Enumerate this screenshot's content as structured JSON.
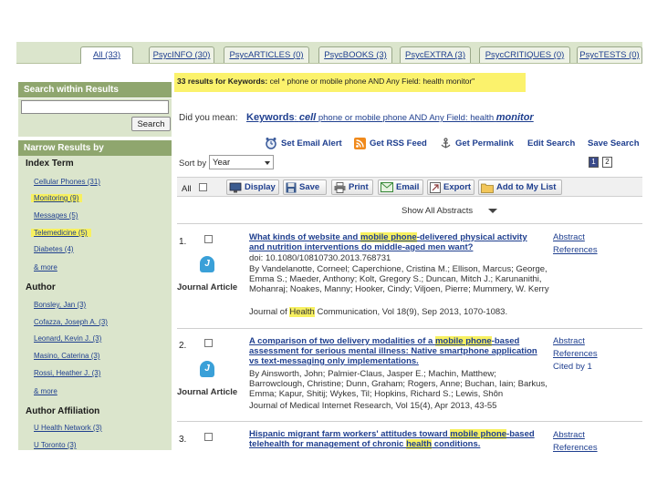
{
  "tabs": [
    {
      "label": "All (33)"
    },
    {
      "label": "PsycINFO (30)"
    },
    {
      "label": "PsycARTICLES (0)"
    },
    {
      "label": "PsycBOOKS (3)"
    },
    {
      "label": "PsycEXTRA (3)"
    },
    {
      "label": "PsycCRITIQUES (0)"
    },
    {
      "label": "PsycTESTS (0)"
    }
  ],
  "search_within": {
    "heading": "Search within Results",
    "input_value": "",
    "button_label": "Search"
  },
  "narrow": {
    "heading": "Narrow Results by",
    "index_term": {
      "heading": "Index Term",
      "items": [
        "Cellular Phones (31)",
        "Monitoring (9)",
        "Messages (5)",
        "Telemedicine (5)",
        "Diabetes (4)"
      ],
      "more": "& more"
    },
    "author": {
      "heading": "Author",
      "items": [
        "Bonsley, Jan (3)",
        "Cofazza, Joseph A. (3)",
        "Leonard, Kevin J. (3)",
        "Masino, Caterina (3)",
        "Rossi, Heather J. (3)"
      ],
      "more": "& more"
    },
    "affiliation": {
      "heading": "Author Affiliation",
      "items": [
        "U Health Network (3)",
        "U Toronto (3)"
      ]
    }
  },
  "query": {
    "count": "33 results for Keywords:",
    "text": "cel * phone or mobile phone AND Any Field: health monitor\""
  },
  "did_you_mean": {
    "label": "Did you mean:",
    "kw": "Keywords",
    "cell": "cell",
    "mid": "phone or mobile phone AND Any Field",
    "health": "health",
    "monitor": "monitor"
  },
  "tools": {
    "email_alert": "Set Email Alert",
    "rss": "Get RSS Feed",
    "permalink": "Get Permalink",
    "edit": "Edit Search",
    "save_search": "Save Search"
  },
  "sort": {
    "label": "Sort by",
    "value": "Year",
    "pages": [
      "1",
      "2"
    ]
  },
  "actions": {
    "all_label": "All",
    "display": "Display",
    "save": "Save",
    "print": "Print",
    "email": "Email",
    "export": "Export",
    "add_list": "Add to My List"
  },
  "show_abstracts": "Show All Abstracts",
  "results": [
    {
      "num": "1.",
      "type": "Journal Article",
      "title_a": "What kinds of website and ",
      "title_hl": "mobile phone",
      "title_b": "-delivered physical activity and nutrition interventions do middle-aged men want?",
      "doi": "doi: 10.1080/10810730.2013.768731",
      "authors": "By Vandelanotte, Corneel; Caperchione, Cristina M.; Ellison, Marcus; George, Emma S.; Maeder, Anthony; Kolt, Gregory S.; Duncan, Mitch J.; Karunanithi, Mohanraj; Noakes, Manny; Hooker, Cindy; Viljoen, Pierre; Mummery, W. Kerry",
      "source_a": "Journal of ",
      "source_hl": "Health",
      "source_b": " Communication, Vol 18(9), Sep 2013, 1070-1083.",
      "links": [
        "Abstract",
        "References"
      ]
    },
    {
      "num": "2.",
      "type": "Journal Article",
      "title_a": "A comparison of two delivery modalities of a ",
      "title_hl": "mobile phone",
      "title_b": "-based assessment for serious mental illness: Native smartphone application vs text-messaging only implementations.",
      "authors": "By Ainsworth, John; Palmier-Claus, Jasper E.; Machin, Matthew; Barrowclough, Christine; Dunn, Graham; Rogers, Anne; Buchan, Iain; Barkus, Emma; Kapur, Shitij; Wykes, Til; Hopkins, Richard S.; Lewis, Shôn",
      "source_a": "Journal of Medical Internet Research, Vol 15(4), Apr 2013, 43-55",
      "links": [
        "Abstract",
        "References",
        "Cited by 1"
      ]
    },
    {
      "num": "3.",
      "title_a": "Hispanic migrant farm workers' attitudes toward ",
      "title_hl": "mobile phone",
      "title_b": "-based telehealth for management of chronic ",
      "title_hl2": "health",
      "title_c": " conditions.",
      "links": [
        "Abstract",
        "References"
      ]
    }
  ],
  "colors": {
    "sidebar_bg": "#dbe5cc",
    "sidebar_head": "#8fa66e",
    "highlight": "#f7f060",
    "link": "#1f3f8f"
  }
}
